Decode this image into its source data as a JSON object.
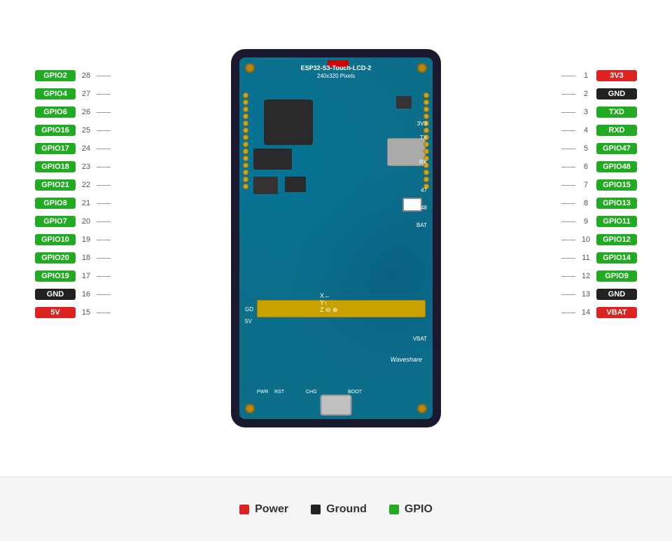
{
  "board": {
    "title": "ESP32-S3-Touch-LCD-2",
    "subtitle": "240x320 Pixels",
    "brand": "Waveshare"
  },
  "left_pins": [
    {
      "label": "GPIO2",
      "num": 28,
      "type": "gpio"
    },
    {
      "label": "GPIO4",
      "num": 27,
      "type": "gpio"
    },
    {
      "label": "GPIO6",
      "num": 26,
      "type": "gpio"
    },
    {
      "label": "GPIO16",
      "num": 25,
      "type": "gpio"
    },
    {
      "label": "GPIO17",
      "num": 24,
      "type": "gpio"
    },
    {
      "label": "GPIO18",
      "num": 23,
      "type": "gpio"
    },
    {
      "label": "GPIO21",
      "num": 22,
      "type": "gpio"
    },
    {
      "label": "GPIO8",
      "num": 21,
      "type": "gpio"
    },
    {
      "label": "GPIO7",
      "num": 20,
      "type": "gpio"
    },
    {
      "label": "GPIO10",
      "num": 19,
      "type": "gpio"
    },
    {
      "label": "GPIO20",
      "num": 18,
      "type": "gpio"
    },
    {
      "label": "GPIO19",
      "num": 17,
      "type": "gpio"
    },
    {
      "label": "GND",
      "num": 16,
      "type": "gnd"
    },
    {
      "label": "5V",
      "num": 15,
      "type": "power"
    }
  ],
  "right_pins": [
    {
      "label": "3V3",
      "num": 1,
      "type": "power"
    },
    {
      "label": "GND",
      "num": 2,
      "type": "gnd"
    },
    {
      "label": "TXD",
      "num": 3,
      "type": "gpio"
    },
    {
      "label": "RXD",
      "num": 4,
      "type": "gpio"
    },
    {
      "label": "GPIO47",
      "num": 5,
      "type": "gpio"
    },
    {
      "label": "GPIO48",
      "num": 6,
      "type": "gpio"
    },
    {
      "label": "GPIO15",
      "num": 7,
      "type": "gpio"
    },
    {
      "label": "GPIO13",
      "num": 8,
      "type": "gpio"
    },
    {
      "label": "GPIO11",
      "num": 9,
      "type": "gpio"
    },
    {
      "label": "GPIO12",
      "num": 10,
      "type": "gpio"
    },
    {
      "label": "GPIO14",
      "num": 11,
      "type": "gpio"
    },
    {
      "label": "GPIO9",
      "num": 12,
      "type": "gpio"
    },
    {
      "label": "GND",
      "num": 13,
      "type": "gnd"
    },
    {
      "label": "VBAT",
      "num": 14,
      "type": "power"
    }
  ],
  "legend": {
    "items": [
      {
        "label": "Power",
        "color": "#dd2222"
      },
      {
        "label": "Ground",
        "color": "#222222"
      },
      {
        "label": "GPIO",
        "color": "#22aa22"
      }
    ]
  }
}
